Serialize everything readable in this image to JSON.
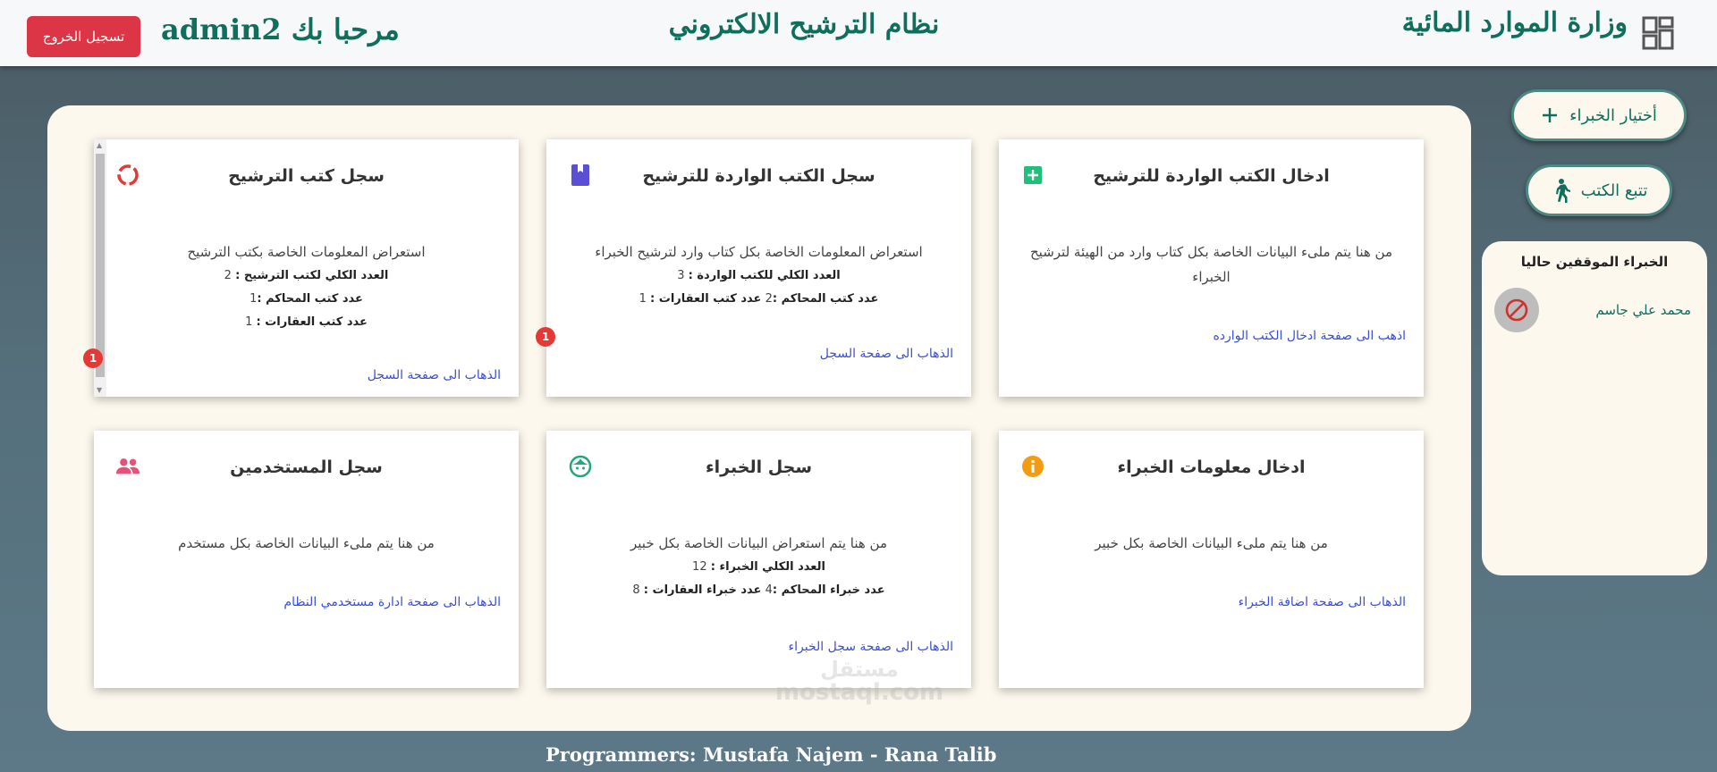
{
  "header": {
    "logout_label": "تسجيل الخروج",
    "welcome_prefix": "مرحبا بك",
    "username": "admin2",
    "app_title": "نظام الترشيح الالكتروني",
    "ministry": "وزارة الموارد المائية",
    "dashboard_icon": "dashboard-grid-icon"
  },
  "cards": [
    {
      "title": "ادخال الكتب الواردة للترشيح",
      "icon": "plus-box-icon",
      "icon_color": "#21c07a",
      "desc": "من هنا يتم ملىء البيانات الخاصة بكل كتاب وارد من الهيئة لترشيح الخبراء",
      "link": "اذهب الى صفحة ادخال الكتب الوارده"
    },
    {
      "title": "سجل الكتب الواردة للترشيح",
      "icon": "book-icon",
      "icon_color": "#5b4fd6",
      "desc": "استعراض المعلومات الخاصة بكل كتاب وارد لترشيح الخبراء",
      "stats": [
        {
          "label": "العدد الكلي للكتب الواردة :",
          "value": "3"
        },
        {
          "label": "عدد كتب المحاكم :",
          "value": "2",
          "label2": "عدد كتب العقارات :",
          "value2": "1"
        }
      ],
      "link": "الذهاب الى صفحة السجل",
      "badge": "1"
    },
    {
      "title": "سجل كتب الترشيح",
      "icon": "donut-icon",
      "icon_color": "#e53935",
      "desc": "استعراض المعلومات الخاصة بكتب الترشيح",
      "stats": [
        {
          "label": "العدد الكلي لكتب الترشيح :",
          "value": "2"
        },
        {
          "label": "عدد كتب المحاكم :",
          "value": "1"
        },
        {
          "label": "عدد كتب العقارات :",
          "value": "1"
        }
      ],
      "link": "الذهاب الى صفحة السجل",
      "badge": "1"
    },
    {
      "title": "ادخال معلومات الخبراء",
      "icon": "info-icon",
      "icon_color": "#f39c12",
      "desc": "من هنا يتم ملىء البيانات الخاصة بكل خبير",
      "link": "الذهاب الى صفحة اضافة الخبراء"
    },
    {
      "title": "سجل الخبراء",
      "icon": "face-icon",
      "icon_color": "#21a87a",
      "desc": "من هنا يتم استعراض البيانات الخاصة بكل خبير",
      "stats": [
        {
          "label": "العدد الكلي الخبراء :",
          "value": "12"
        },
        {
          "label": "عدد خبراء المحاكم :",
          "value": "4",
          "label2": "عدد خبراء العقارات :",
          "value2": "8"
        }
      ],
      "link": "الذهاب الى صفحة سجل الخبراء"
    },
    {
      "title": "سجل المستخدمين",
      "icon": "users-icon",
      "icon_color": "#e8507a",
      "desc": "من هنا يتم ملىء البيانات الخاصة بكل مستخدم",
      "link": "الذهاب الى صفحة ادارة مستخدمي النظام"
    }
  ],
  "side": {
    "choose_experts_label": "أختيار الخبراء",
    "track_books_label": "تتبع الكتب",
    "stopped_title": "الخبراء الموقفين حاليا",
    "stopped_items": [
      {
        "name": "محمد علي جاسم",
        "icon": "block-icon"
      }
    ]
  },
  "footer": {
    "credits": "Programmers: Mustafa Najem - Rana Talib"
  },
  "watermark": {
    "line1": "مستقل",
    "line2": "mostaql.com"
  }
}
